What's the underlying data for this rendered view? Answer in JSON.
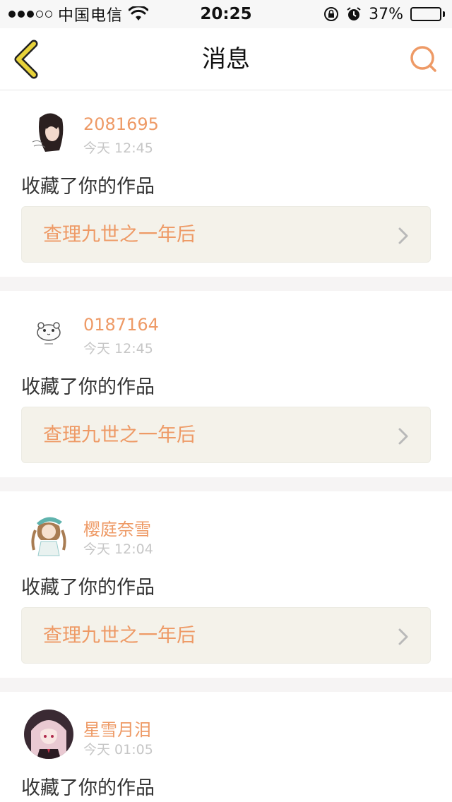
{
  "status_bar": {
    "carrier": "中国电信",
    "time": "20:25",
    "battery": "37%",
    "battery_level": 0.37
  },
  "nav": {
    "title": "消息",
    "back_icon": "chevron-left-icon",
    "search_icon": "search-icon"
  },
  "colors": {
    "accent": "#ee9a66",
    "back_icon": "#e7d23a",
    "link_background": "#f4f2ea",
    "separator": "#f6f4f4"
  },
  "messages": [
    {
      "user": "2081695",
      "time": "今天 12:45",
      "action": "收藏了你的作品",
      "work_title": "查理九世之一年后"
    },
    {
      "user": "0187164",
      "time": "今天 12:45",
      "action": "收藏了你的作品",
      "work_title": "查理九世之一年后"
    },
    {
      "user": "樱庭奈雪",
      "time": "今天 12:04",
      "action": "收藏了你的作品",
      "work_title": "查理九世之一年后"
    },
    {
      "user": "星雪月泪",
      "time": "今天 01:05",
      "action": "收藏了你的作品"
    }
  ]
}
